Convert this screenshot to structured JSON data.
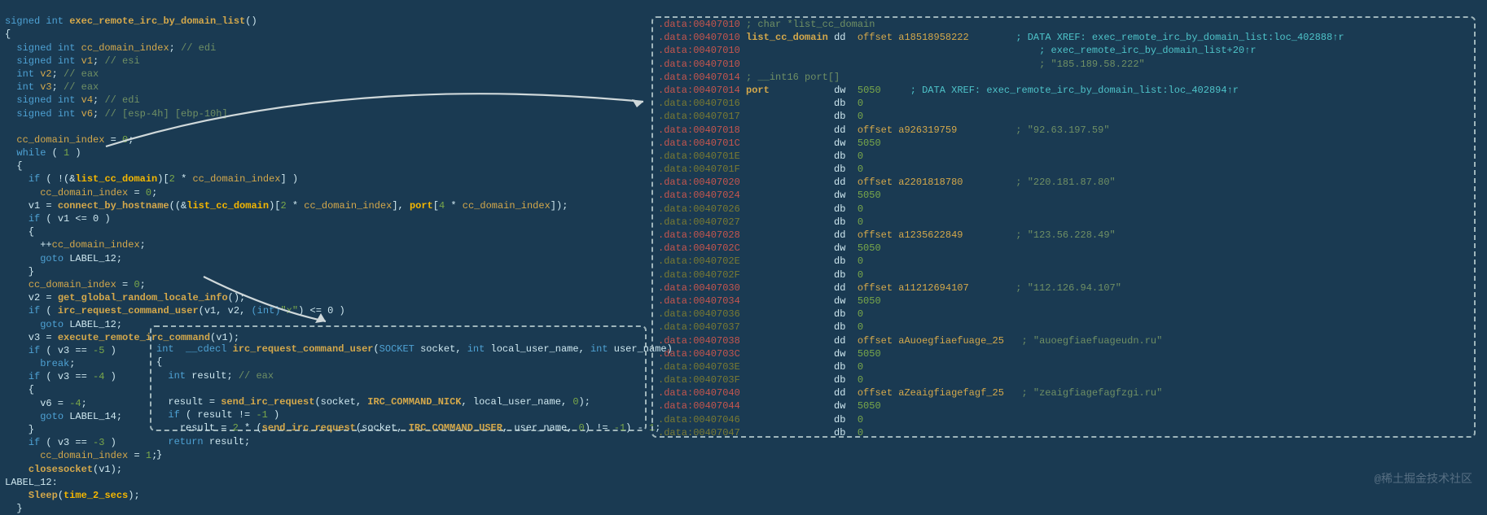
{
  "watermark": "@稀土掘金技术社区",
  "left_code": {
    "sig": {
      "ret": "signed int",
      "name": "exec_remote_irc_by_domain_list"
    },
    "decls": [
      {
        "type": "signed int",
        "name": "cc_domain_index",
        "cmt": "// edi"
      },
      {
        "type": "signed int",
        "name": "v1",
        "cmt": "// esi"
      },
      {
        "type": "int",
        "name": "v2",
        "cmt": "// eax"
      },
      {
        "type": "int",
        "name": "v3",
        "cmt": "// eax"
      },
      {
        "type": "signed int",
        "name": "v4",
        "cmt": "// edi"
      },
      {
        "type": "signed int",
        "name": "v6",
        "cmt": "// [esp-4h] [ebp-10h]"
      }
    ],
    "lines": {
      "init": "cc_domain_index",
      "zero": "0",
      "whilekw": "while",
      "one": "1",
      "ifkw": "if",
      "not": "!",
      "amp": "&",
      "list": "list_cc_domain",
      "mult2": "2",
      "idx": "cc_domain_index",
      "conn": "connect_by_hostname",
      "port": "port",
      "mult4": "4",
      "lteq0": " <= 0",
      "inc": "++",
      "goto": "goto",
      "lbl12": "LABEL_12",
      "getinfo": "get_global_random_locale_info",
      "ircreq": "irc_request_command_user",
      "cast": "(int)",
      "xstr": "\"x\"",
      "execrem": "execute_remote_irc_command",
      "eqm5": "-5",
      "brk": "break",
      "eqm4": "-4",
      "neg4": "-4",
      "lbl14": "LABEL_14",
      "eqm3": "-3",
      "assign1": "1",
      "close": "closesocket",
      "sleep": "Sleep",
      "t2s": "time_2_secs"
    }
  },
  "inner_code": {
    "sig": {
      "ret": "int",
      "cc": "__cdecl",
      "name": "irc_request_command_user",
      "p1t": "SOCKET",
      "p1n": "socket",
      "p2t": "int",
      "p2n": "local_user_name",
      "p3t": "int",
      "p3n": "user_name"
    },
    "decl": {
      "type": "int",
      "name": "result",
      "cmt": "// eax"
    },
    "sendirc": "send_irc_request",
    "s": "socket",
    "nick": "IRC_COMMAND_NICK",
    "l": "local_user_name",
    "z": "0",
    "nem1": "!=",
    "m1": "-1",
    "two": "2",
    "user": "IRC_COMMAND_USER",
    "u": "user_name",
    "ret": "return",
    "res": "result"
  },
  "data_rows": [
    {
      "addr": "00407010",
      "c": "r",
      "type": "cmt",
      "text": "; char *list_cc_domain"
    },
    {
      "addr": "00407010",
      "c": "r",
      "type": "dd",
      "label": "list_cc_domain",
      "val": "offset a18518958222",
      "xref": "; DATA XREF: exec_remote_irc_by_domain_list:loc_402888↑r"
    },
    {
      "addr": "00407010",
      "c": "r",
      "type": "blank",
      "xref": "; exec_remote_irc_by_domain_list+20↑r"
    },
    {
      "addr": "00407010",
      "c": "r",
      "type": "blank",
      "strc": "; \"185.189.58.222\""
    },
    {
      "addr": "00407014",
      "c": "r",
      "type": "cmt",
      "text": "; __int16 port[]"
    },
    {
      "addr": "00407014",
      "c": "r",
      "type": "dw",
      "label": "port",
      "val": "5050",
      "xref": "; DATA XREF: exec_remote_irc_by_domain_list:loc_402894↑r"
    },
    {
      "addr": "00407016",
      "c": "o",
      "type": "db",
      "val": "0"
    },
    {
      "addr": "00407017",
      "c": "o",
      "type": "db",
      "val": "0"
    },
    {
      "addr": "00407018",
      "c": "r",
      "type": "dd",
      "val": "offset a926319759",
      "strc": "; \"92.63.197.59\""
    },
    {
      "addr": "0040701C",
      "c": "r",
      "type": "dw",
      "val": "5050"
    },
    {
      "addr": "0040701E",
      "c": "o",
      "type": "db",
      "val": "0"
    },
    {
      "addr": "0040701F",
      "c": "o",
      "type": "db",
      "val": "0"
    },
    {
      "addr": "00407020",
      "c": "r",
      "type": "dd",
      "val": "offset a2201818780",
      "strc": "; \"220.181.87.80\""
    },
    {
      "addr": "00407024",
      "c": "r",
      "type": "dw",
      "val": "5050"
    },
    {
      "addr": "00407026",
      "c": "o",
      "type": "db",
      "val": "0"
    },
    {
      "addr": "00407027",
      "c": "o",
      "type": "db",
      "val": "0"
    },
    {
      "addr": "00407028",
      "c": "r",
      "type": "dd",
      "val": "offset a1235622849",
      "strc": "; \"123.56.228.49\""
    },
    {
      "addr": "0040702C",
      "c": "r",
      "type": "dw",
      "val": "5050"
    },
    {
      "addr": "0040702E",
      "c": "o",
      "type": "db",
      "val": "0"
    },
    {
      "addr": "0040702F",
      "c": "o",
      "type": "db",
      "val": "0"
    },
    {
      "addr": "00407030",
      "c": "r",
      "type": "dd",
      "val": "offset a11212694107",
      "strc": "; \"112.126.94.107\""
    },
    {
      "addr": "00407034",
      "c": "r",
      "type": "dw",
      "val": "5050"
    },
    {
      "addr": "00407036",
      "c": "o",
      "type": "db",
      "val": "0"
    },
    {
      "addr": "00407037",
      "c": "o",
      "type": "db",
      "val": "0"
    },
    {
      "addr": "00407038",
      "c": "r",
      "type": "dd",
      "val": "offset aAuoegfiaefuage_25",
      "strc": "; \"auoegfiaefuageudn.ru\""
    },
    {
      "addr": "0040703C",
      "c": "r",
      "type": "dw",
      "val": "5050"
    },
    {
      "addr": "0040703E",
      "c": "o",
      "type": "db",
      "val": "0"
    },
    {
      "addr": "0040703F",
      "c": "o",
      "type": "db",
      "val": "0"
    },
    {
      "addr": "00407040",
      "c": "r",
      "type": "dd",
      "val": "offset aZeaigfiagefagf_25",
      "strc": "; \"zeaigfiagefagfzgi.ru\""
    },
    {
      "addr": "00407044",
      "c": "r",
      "type": "dw",
      "val": "5050"
    },
    {
      "addr": "00407046",
      "c": "o",
      "type": "db",
      "val": "0"
    },
    {
      "addr": "00407047",
      "c": "o",
      "type": "db",
      "val": "0"
    }
  ]
}
